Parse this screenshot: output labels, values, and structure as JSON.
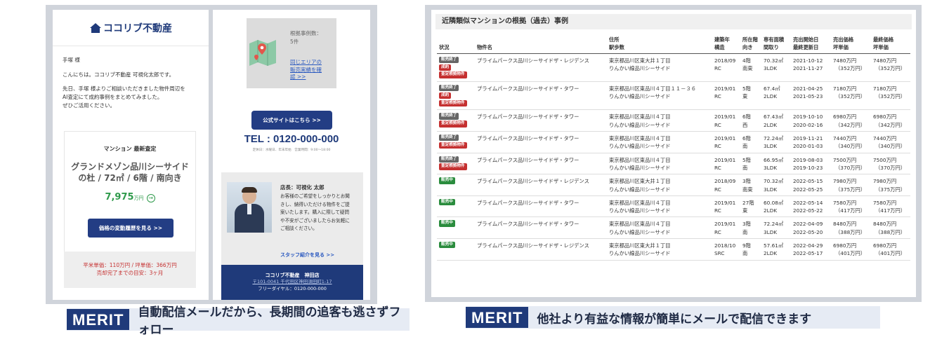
{
  "email": {
    "logo": "ココリブ不動産",
    "greeting": "手塚 様",
    "intro": "こんにちは。ココリブ不動産 可視化太郎です。",
    "message": [
      "先日、手塚 様よりご相談いただきました物件周辺を",
      "AI査定にて成約事例をまとめてみました。",
      "ぜひご活用ください。"
    ],
    "card_label": "マンション 最新査定",
    "property_name_line1": "グランドメゾン品川シーサイド",
    "property_name_line2": "の杜 / 72㎡ / 6階 / 南向き",
    "price_value": "7,975",
    "price_unit": "万円",
    "history_button": "価格の変動履歴を見る >>",
    "unit_price": "平米単価：110万円 / 坪単価：366万円",
    "sell_period": "売却完了までの目安：3ヶ月"
  },
  "email2": {
    "map_count_label": "根拠事例数：",
    "map_count_value": "5件",
    "map_link": [
      "同じエリアの",
      "販売実績を確",
      "認 >>"
    ],
    "site_button": "公式サイトはこちら >>",
    "tel": "TEL : 0120-000-000",
    "hours": "定休日：水曜日、年末年始　営業時間：9:00～18:00",
    "manager_title": "店長：可視化 太郎",
    "manager_message": [
      "お客様のご希望をしっかりとお聞",
      "きし、納得いただける物件をご提",
      "案いたします。購入に際して疑問",
      "や不安がございましたらお気軽に",
      "ご相談ください。"
    ],
    "staff_link": "スタッフ紹介を見る >>",
    "footer_name": "ココリブ不動産　神田店",
    "footer_address": "〒101-0041 千代田区神田須田町1-17",
    "footer_dial": "フリーダイヤル：0120-000-000"
  },
  "captions": [
    {
      "tag": "MERIT",
      "text": "自動配信メールだから、長期間の追客も逃さずフォロー"
    },
    {
      "tag": "MERIT",
      "text": "他社より有益な情報が簡単にメールで配信できます"
    }
  ],
  "table": {
    "title": "近隣類似マンションの根拠（過去）事例",
    "headers": {
      "status": "状況",
      "name": "物件名",
      "address": [
        "住所",
        "駅歩数"
      ],
      "built": [
        "建築年",
        "構造"
      ],
      "floor": [
        "所在階",
        "向き"
      ],
      "area": [
        "専有面積",
        "間取り"
      ],
      "dates": [
        "売出開始日",
        "最終更新日"
      ],
      "sale": [
        "売出価格",
        "坪単価"
      ],
      "final": [
        "最終価格",
        "坪単価"
      ]
    },
    "rows": [
      {
        "badges": [
          [
            "販売終了",
            "gray"
          ],
          [
            "成約",
            "red"
          ],
          [
            "査定根拠物件",
            "red"
          ]
        ],
        "name": "プライムパークス品川シーサイドザ・レジデンス",
        "addr": "東京都品川区東大井１丁目",
        "station": "りんかい線品川シーサイド",
        "year": "2018/09",
        "struct": "RC",
        "floor": "4階",
        "dir": "南東",
        "area": "70.32㎡",
        "layout": "3LDK",
        "start": "2021-10-12",
        "updated": "2021-11-27",
        "price": "7480万円",
        "tsubo": "（352万円）",
        "final": "7480万円",
        "final_tsubo": "（352万円）"
      },
      {
        "badges": [
          [
            "販売終了",
            "gray"
          ],
          [
            "成約",
            "red"
          ],
          [
            "査定根拠物件",
            "red"
          ]
        ],
        "name": "プライムパークス品川シーサイドザ・タワー",
        "addr": "東京都品川区東品川４丁目１１－３６",
        "station": "りんかい線品川シーサイド",
        "year": "2019/01",
        "struct": "RC",
        "floor": "5階",
        "dir": "東",
        "area": "67.4㎡",
        "layout": "2LDK",
        "start": "2021-04-25",
        "updated": "2021-05-23",
        "price": "7180万円",
        "tsubo": "（352万円）",
        "final": "7180万円",
        "final_tsubo": "（352万円）"
      },
      {
        "badges": [
          [
            "販売終了",
            "gray"
          ],
          [
            "査定根拠物件",
            "red"
          ]
        ],
        "name": "プライムパークス品川シーサイドザ・タワー",
        "addr": "東京都品川区東品川４丁目",
        "station": "りんかい線品川シーサイド",
        "year": "2019/01",
        "struct": "RC",
        "floor": "6階",
        "dir": "西",
        "area": "67.43㎡",
        "layout": "2LDK",
        "start": "2019-10-10",
        "updated": "2020-02-16",
        "price": "6980万円",
        "tsubo": "（342万円）",
        "final": "6980万円",
        "final_tsubo": "（342万円）"
      },
      {
        "badges": [
          [
            "販売終了",
            "gray"
          ],
          [
            "査定根拠物件",
            "red"
          ]
        ],
        "name": "プライムパークス品川シーサイドザ・タワー",
        "addr": "東京都品川区東品川４丁目",
        "station": "りんかい線品川シーサイド",
        "year": "2019/01",
        "struct": "RC",
        "floor": "6階",
        "dir": "南",
        "area": "72.24㎡",
        "layout": "3LDK",
        "start": "2019-11-21",
        "updated": "2020-01-03",
        "price": "7440万円",
        "tsubo": "（340万円）",
        "final": "7440万円",
        "final_tsubo": "（340万円）"
      },
      {
        "badges": [
          [
            "販売終了",
            "gray"
          ],
          [
            "査定根拠物件",
            "red"
          ]
        ],
        "name": "プライムパークス品川シーサイドザ・タワー",
        "addr": "東京都品川区東品川４丁目",
        "station": "りんかい線品川シーサイド",
        "year": "2019/01",
        "struct": "RC",
        "floor": "5階",
        "dir": "南",
        "area": "66.95㎡",
        "layout": "3LDK",
        "start": "2019-08-03",
        "updated": "2019-10-23",
        "price": "7500万円",
        "tsubo": "（370万円）",
        "final": "7500万円",
        "final_tsubo": "（370万円）"
      },
      {
        "badges": [
          [
            "販売中",
            "green"
          ]
        ],
        "name": "プライムパークス品川シーサイドザ・レジデンス",
        "addr": "東京都品川区東大井１丁目",
        "station": "りんかい線品川シーサイド",
        "year": "2018/09",
        "struct": "RC",
        "floor": "3階",
        "dir": "南東",
        "area": "70.32㎡",
        "layout": "3LDK",
        "start": "2022-05-15",
        "updated": "2022-05-25",
        "price": "7980万円",
        "tsubo": "（375万円）",
        "final": "7980万円",
        "final_tsubo": "（375万円）"
      },
      {
        "badges": [
          [
            "販売中",
            "green"
          ]
        ],
        "name": "プライムパークス品川シーサイドザ・タワー",
        "addr": "東京都品川区東品川４丁目",
        "station": "りんかい線品川シーサイド",
        "year": "2019/01",
        "struct": "RC",
        "floor": "27階",
        "dir": "東",
        "area": "60.08㎡",
        "layout": "2LDK",
        "start": "2022-05-14",
        "updated": "2022-05-22",
        "price": "7580万円",
        "tsubo": "（417万円）",
        "final": "7580万円",
        "final_tsubo": "（417万円）"
      },
      {
        "badges": [
          [
            "販売中",
            "green"
          ]
        ],
        "name": "プライムパークス品川シーサイドザ・タワー",
        "addr": "東京都品川区東品川４丁目",
        "station": "りんかい線品川シーサイド",
        "year": "2019/01",
        "struct": "RC",
        "floor": "3階",
        "dir": "南",
        "area": "72.24㎡",
        "layout": "3LDK",
        "start": "2022-04-09",
        "updated": "2022-05-20",
        "price": "8480万円",
        "tsubo": "（388万円）",
        "final": "8480万円",
        "final_tsubo": "（388万円）"
      },
      {
        "badges": [
          [
            "販売中",
            "green"
          ]
        ],
        "name": "プライムパークス品川シーサイドザ・レジデンス",
        "addr": "東京都品川区東大井１丁目",
        "station": "りんかい線品川シーサイド",
        "year": "2018/10",
        "struct": "SRC",
        "floor": "9階",
        "dir": "南",
        "area": "57.61㎡",
        "layout": "2LDK",
        "start": "2022-04-29",
        "updated": "2022-05-17",
        "price": "6980万円",
        "tsubo": "（401万円）",
        "final": "6980万円",
        "final_tsubo": "（401万円）"
      }
    ]
  }
}
